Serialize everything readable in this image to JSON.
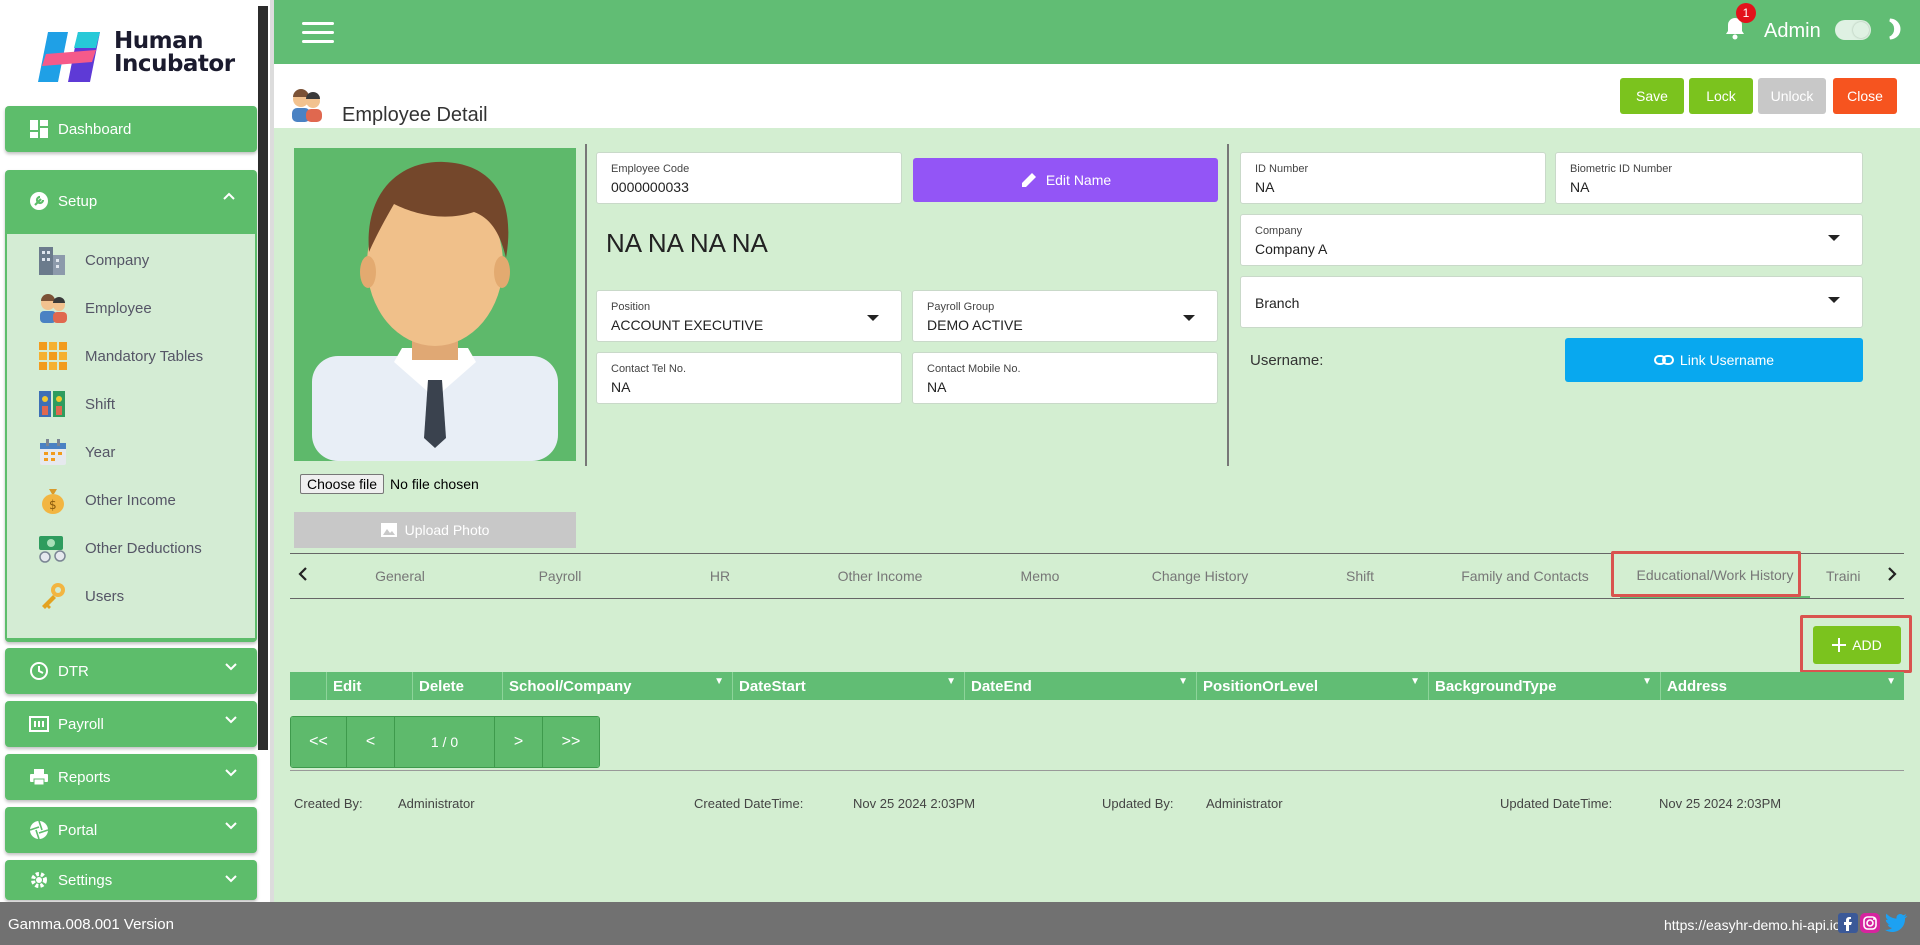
{
  "brand": {
    "line1": "Human",
    "line2": "Incubator"
  },
  "sidebar": {
    "dashboard": "Dashboard",
    "setup": "Setup",
    "setup_items": [
      "Company",
      "Employee",
      "Mandatory Tables",
      "Shift",
      "Year",
      "Other Income",
      "Other Deductions",
      "Users"
    ],
    "dtr": "DTR",
    "payroll": "Payroll",
    "reports": "Reports",
    "portal": "Portal",
    "settings": "Settings"
  },
  "topbar": {
    "notifications": "1",
    "user": "Admin"
  },
  "header": {
    "title": "Employee Detail",
    "save": "Save",
    "lock": "Lock",
    "unlock": "Unlock",
    "close": "Close"
  },
  "photo": {
    "choose_file": "Choose file",
    "no_file": "No file chosen",
    "upload": "Upload Photo"
  },
  "form": {
    "employee_code": {
      "label": "Employee Code",
      "value": "0000000033"
    },
    "edit_name": "Edit Name",
    "full_name": "NA NA  NA NA",
    "position": {
      "label": "Position",
      "value": "ACCOUNT EXECUTIVE"
    },
    "payroll_group": {
      "label": "Payroll Group",
      "value": "DEMO ACTIVE"
    },
    "contact_tel": {
      "label": "Contact Tel No.",
      "value": "NA"
    },
    "contact_mobile": {
      "label": "Contact Mobile No.",
      "value": "NA"
    },
    "id_number": {
      "label": "ID Number",
      "value": "NA"
    },
    "biometric_id": {
      "label": "Biometric ID Number",
      "value": "NA"
    },
    "company": {
      "label": "Company",
      "value": "Company A"
    },
    "branch": {
      "value": "Branch"
    },
    "username_label": "Username:",
    "link_username": "Link Username"
  },
  "tabs": [
    "General",
    "Payroll",
    "HR",
    "Other Income",
    "Memo",
    "Change History",
    "Shift",
    "Family and Contacts",
    "Educational/Work History",
    "Traini"
  ],
  "active_tab": "Educational/Work History",
  "grid": {
    "add": "ADD",
    "columns": [
      "Edit",
      "Delete",
      "School/Company",
      "DateStart",
      "DateEnd",
      "PositionOrLevel",
      "BackgroundType",
      "Address"
    ],
    "pager": {
      "first": "<<",
      "prev": "<",
      "page": "1 / 0",
      "next": ">",
      "last": ">>"
    }
  },
  "audit": {
    "created_by_label": "Created By:",
    "created_by": "Administrator",
    "created_dt_label": "Created DateTime:",
    "created_dt": "Nov 25 2024 2:03PM",
    "updated_by_label": "Updated By:",
    "updated_by": "Administrator",
    "updated_dt_label": "Updated DateTime:",
    "updated_dt": "Nov 25 2024 2:03PM"
  },
  "footer": {
    "version": "Gamma.008.001 Version",
    "url": "https://easyhr-demo.hi-api.io"
  },
  "colors": {
    "green": "#61bd74",
    "accent_purple": "#9355f6",
    "accent_blue": "#08a8ef",
    "close_red": "#f6541f",
    "lime": "#7bc31e"
  }
}
